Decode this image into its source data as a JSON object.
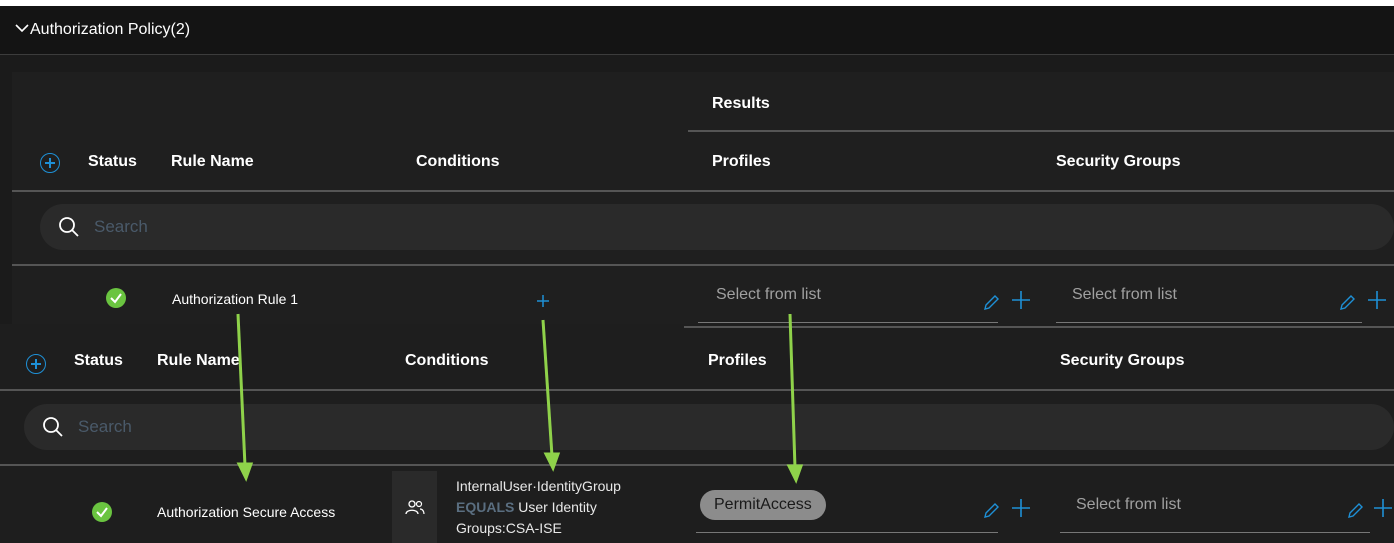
{
  "header": {
    "title": "Authorization Policy(2)"
  },
  "table_top": {
    "results_label": "Results",
    "columns": {
      "status": "Status",
      "rule_name": "Rule Name",
      "conditions": "Conditions",
      "profiles": "Profiles",
      "security_groups": "Security Groups"
    },
    "search_placeholder": "Search",
    "row": {
      "name": "Authorization Rule 1",
      "profiles_placeholder": "Select from list",
      "security_groups_placeholder": "Select from list"
    }
  },
  "table_bottom": {
    "columns": {
      "status": "Status",
      "rule_name": "Rule Name",
      "conditions": "Conditions",
      "profiles": "Profiles",
      "security_groups": "Security Groups"
    },
    "search_placeholder": "Search",
    "row": {
      "name": "Authorization Secure Access",
      "condition_line1": "InternalUser·IdentityGroup",
      "condition_operator": "EQUALS",
      "condition_line2_rest": "User Identity",
      "condition_line3": "Groups:CSA-ISE",
      "profile_tag": "PermitAccess",
      "security_groups_placeholder": "Select from list"
    }
  },
  "colors": {
    "accent_blue": "#1e90d6",
    "status_green": "#6ac440",
    "annotation_arrow": "#8fd24a"
  }
}
